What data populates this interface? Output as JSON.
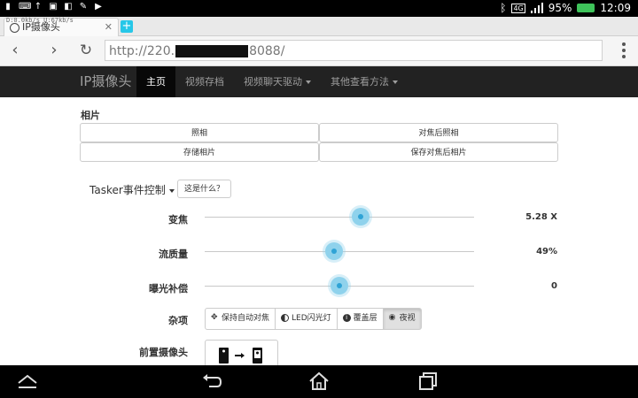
{
  "status_bar": {
    "battery_percent": "95%",
    "time": "12:09",
    "network": "4G"
  },
  "browser": {
    "tab_title": "IP摄像头",
    "tab_speed": "D:0.0kb/s U:67kb/s",
    "url_prefix": "http://220.",
    "url_suffix": "8088/"
  },
  "navbar": {
    "brand": "IP摄像头",
    "items": [
      {
        "label": "主页"
      },
      {
        "label": "视频存档"
      },
      {
        "label": "视频聊天驱动"
      },
      {
        "label": "其他查看方法"
      }
    ]
  },
  "photo": {
    "heading": "相片",
    "buttons": [
      "照相",
      "对焦后照相",
      "存储相片",
      "保存对焦后相片"
    ]
  },
  "tasker": {
    "label": "Tasker事件控制",
    "help_button": "这是什么？"
  },
  "sliders": [
    {
      "label": "变焦",
      "value_text": "5.28 X",
      "fraction": 0.58
    },
    {
      "label": "流质量",
      "value_text": "49%",
      "fraction": 0.48
    },
    {
      "label": "曝光补偿",
      "value_text": "0",
      "fraction": 0.5
    }
  ],
  "misc": {
    "label": "杂项",
    "buttons": [
      "保持自动对焦",
      "LED闪光灯",
      "覆盖层",
      "夜视"
    ],
    "active_button": "夜视"
  },
  "front_camera": {
    "label": "前置摄像头"
  },
  "colors": {
    "navbar_bg": "#222222",
    "slider_knob": "#8fd2ec",
    "new_tab": "#26c7e8",
    "battery": "#3ec35a"
  }
}
